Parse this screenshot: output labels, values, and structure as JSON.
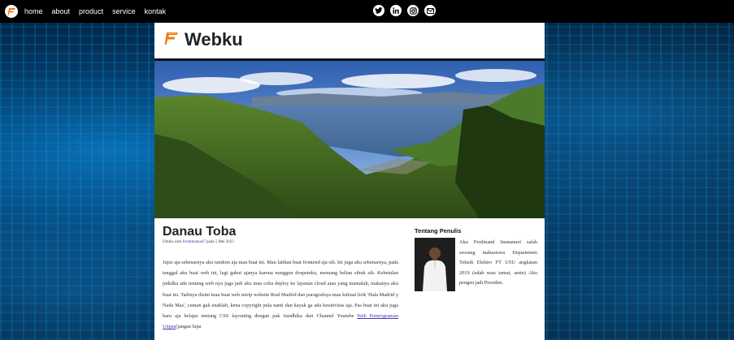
{
  "nav": {
    "links": [
      "home",
      "about",
      "product",
      "service",
      "kontak"
    ]
  },
  "social": [
    "twitter-icon",
    "linkedin-icon",
    "instagram-icon",
    "gmail-icon"
  ],
  "header": {
    "title": "Webku"
  },
  "article": {
    "title": "Danau Toba",
    "meta_prefix": "Ditulis oleh",
    "author": "ferimmanuel7",
    "meta_suffix": "pada 5 Mei 2023",
    "body_main": "Jujur aja sebenarnya aku random aja mau buat ini. Mau latihan buat frontend aja sih. Ini juga aku sebenarnya, pada tanggal aku buat web ini, lagi gabut ajanya karena nunggun dospemku, memang beliau sibuk sih. Kebetulan judulku ada tentang web nya juga jadi aku mau coba deploy ke layanan cloud atau yang mamalah, makanya aku buat ini. Tadinya disini mau buat web mirip website Real Madrid dan paragrafnya mau kubuat lirik 'Hala Madrid y Nada Mas', cuman gak enaklah, kena copyright pula nanti dan kayak ga ada kreativitas aja. Pas buat ini aku juga baru aja belajar tentang CSS layouting dengan pak Sandhika dari Channel Youtube",
    "link_text": "Web Pemrograman Unpas",
    "body_tail": "(jangan lupa"
  },
  "aside": {
    "heading": "Tentang Penulis",
    "bio": "Aku Ferdinand Immanuel salah seorang mahasiswa Departemen Teknik Elektro FT USU angkatan 2019 (udah mau tamat, amin) Aku pengen jadi Presiden."
  },
  "colors": {
    "accent": "#f07a12",
    "link": "#4a2fb3",
    "nav_bg": "#000000"
  }
}
